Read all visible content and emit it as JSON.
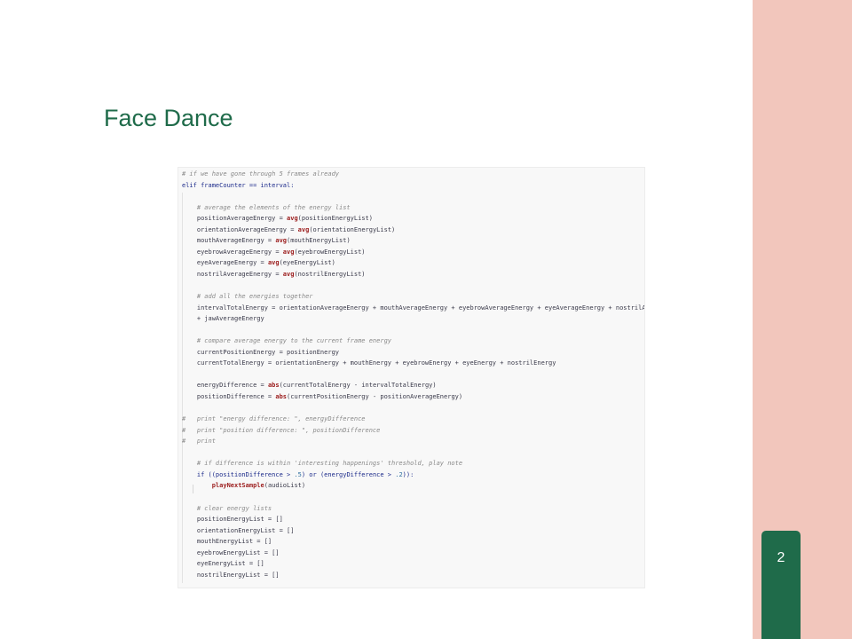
{
  "slide": {
    "title": "Face Dance",
    "page_number": "2",
    "colors": {
      "title": "#1f6b4a",
      "side_band": "#f2c6bc",
      "page_tab": "#1f6b4a"
    }
  },
  "code": {
    "lines": [
      "# if we have gone through 5 frames already",
      "elif frameCounter == interval:",
      "",
      "    # average the elements of the energy list",
      "    positionAverageEnergy = avg(positionEnergyList)",
      "    orientationAverageEnergy = avg(orientationEnergyList)",
      "    mouthAverageEnergy = avg(mouthEnergyList)",
      "    eyebrowAverageEnergy = avg(eyebrowEnergyList)",
      "    eyeAverageEnergy = avg(eyeEnergyList)",
      "    nostrilAverageEnergy = avg(nostrilEnergyList)",
      "",
      "    # add all the energies together",
      "    intervalTotalEnergy = orientationAverageEnergy + mouthAverageEnergy + eyebrowAverageEnergy + eyeAverageEnergy + nostrilAverageEnergy #",
      "    + jawAverageEnergy",
      "",
      "    # compare average energy to the current frame energy",
      "    currentPositionEnergy = positionEnergy",
      "    currentTotalEnergy = orientationEnergy + mouthEnergy + eyebrowEnergy + eyeEnergy + nostrilEnergy",
      "",
      "    energyDifference = abs(currentTotalEnergy - intervalTotalEnergy)",
      "    positionDifference = abs(currentPositionEnergy - positionAverageEnergy)",
      "",
      "#   print \"energy difference: \", energyDifference",
      "#   print \"position difference: \", positionDifference",
      "#   print",
      "",
      "    # if difference is within 'interesting happenings' threshold, play note",
      "    if ((positionDifference > .5) or (energyDifference > .2)):",
      "        playNextSample(audioList)",
      "",
      "    # clear energy lists",
      "    positionEnergyList = []",
      "    orientationEnergyList = []",
      "    mouthEnergyList = []",
      "    eyebrowEnergyList = []",
      "    eyeEnergyList = []",
      "    nostrilEnergyList = []"
    ]
  }
}
